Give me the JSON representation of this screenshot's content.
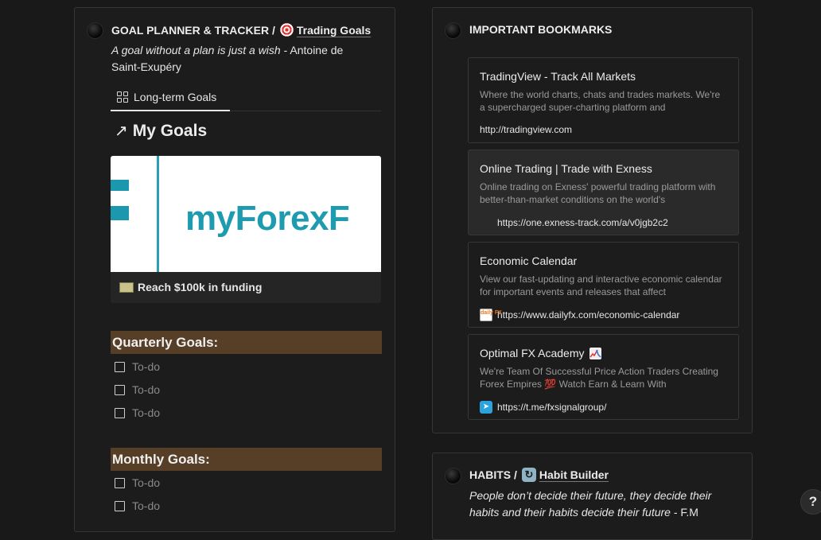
{
  "goal_planner": {
    "title": "GOAL PLANNER & TRACKER /",
    "link_label": "Trading Goals",
    "link_icon": "target-icon",
    "quote_italic": "A goal without a plan is just a wish",
    "quote_author": " - Antoine de Saint-Exupéry",
    "tab_label": "Long-term Goals",
    "tab_icon": "grid-icon",
    "section_title": "My Goals",
    "section_icon": "arrow-up-right-icon",
    "card": {
      "image_logo_text": "myForexF",
      "title": "Reach $100k in funding",
      "icon": "money-icon"
    },
    "quarterly": {
      "title": "Quarterly Goals:",
      "todos": [
        "To-do",
        "To-do",
        "To-do"
      ]
    },
    "monthly": {
      "title": "Monthly Goals:",
      "todos": [
        "To-do",
        "To-do"
      ]
    }
  },
  "bookmarks": {
    "title": "IMPORTANT BOOKMARKS",
    "items": [
      {
        "title": "TradingView - Track All Markets",
        "description": "Where the world charts, chats and trades markets. We're a supercharged super-charting platform and",
        "url": "http://tradingview.com",
        "favicon": "none"
      },
      {
        "title": "Online Trading | Trade with Exness",
        "description": "Online trading on Exness' powerful trading platform with better-than-market conditions on the world's",
        "url": "https://one.exness-track.com/a/v0jgb2c2",
        "favicon": "blank"
      },
      {
        "title": "Economic Calendar",
        "description": "View our fast-updating and interactive economic calendar for important events and releases that affect",
        "url": "https://www.dailyfx.com/economic-calendar",
        "favicon": "dailyfx-icon",
        "favicon_text": "daily FX"
      },
      {
        "title": "Optimal FX Academy",
        "title_icon": "chart-up-down-icon",
        "description": "We're Team Of Successful Price Action Traders Creating Forex Empires 💯 Watch Earn & Learn With",
        "url": "https://t.me/fxsignalgroup/",
        "favicon": "telegram-icon"
      }
    ]
  },
  "habits": {
    "title": "HABITS /",
    "link_label": "Habit Builder",
    "link_icon": "recycle-icon",
    "quote_italic": "People don’t decide their future, they decide their habits and their habits decide their future",
    "quote_author": " - F.M"
  },
  "help_button": "?"
}
